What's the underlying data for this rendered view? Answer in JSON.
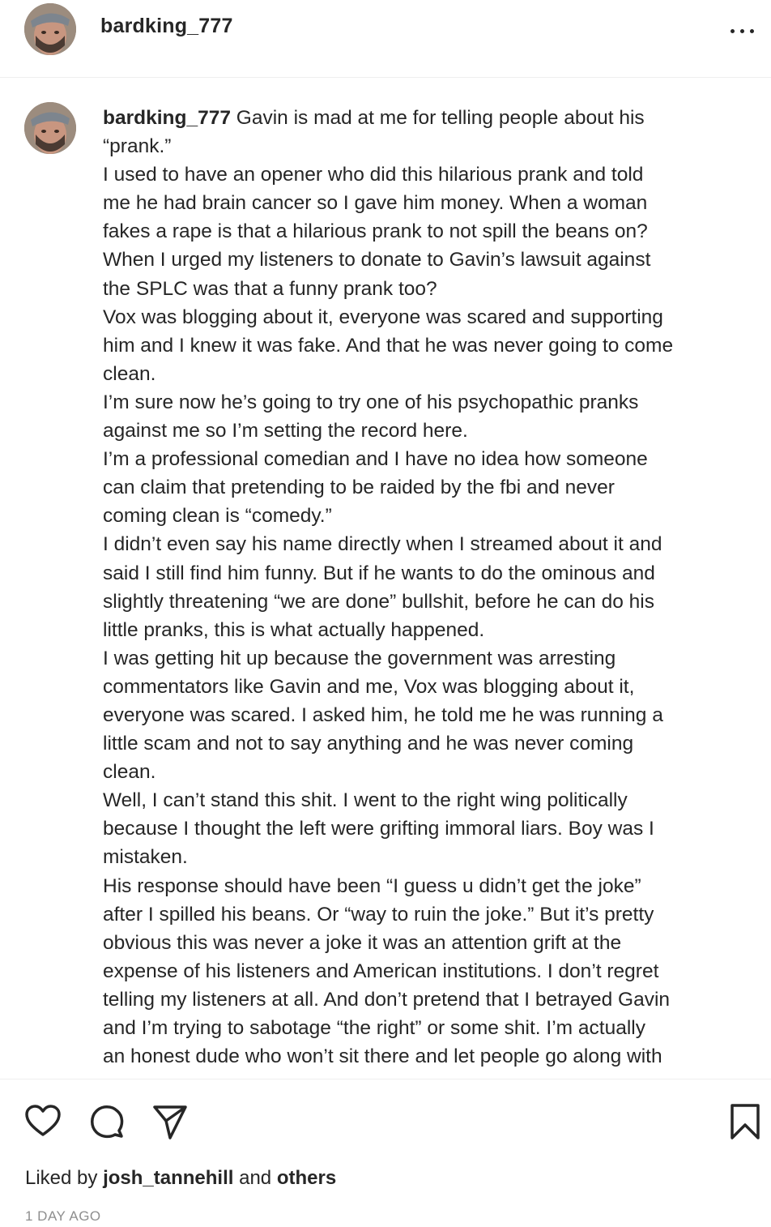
{
  "post": {
    "author": "bardking_777",
    "more_icon": "more-horizontal-icon"
  },
  "comment": {
    "author": "bardking_777",
    "first_line": "Gavin is mad at me for telling people about his",
    "lines": [
      "“prank.”",
      "I used to have an opener who did this hilarious prank and told",
      "me he had brain cancer so I gave him money. When a woman",
      "fakes a rape is that a hilarious prank to not spill the beans on?",
      "When I urged my listeners to donate to Gavin’s lawsuit against",
      "the SPLC was that a funny prank too?",
      "Vox was blogging about it, everyone was scared and supporting",
      "him and I knew it was fake. And that he was never going to come",
      "clean.",
      "I’m sure now he’s going to try one of his psychopathic pranks",
      "against me so I’m setting the record here.",
      "I’m a professional comedian and I have no idea how someone",
      "can claim that pretending to be raided by the fbi and never",
      "coming clean is “comedy.”",
      "I didn’t even say his name directly when I streamed about it and",
      "said I still find him funny. But if he wants to do the ominous and",
      "slightly threatening “we are done” bullshit, before he can do his",
      "little pranks, this is what actually happened.",
      "I was getting hit up because the government was arresting",
      "commentators like Gavin and me, Vox was blogging about it,",
      "everyone was scared. I asked him, he told me he was running a",
      "little scam and not to say anything and he was never coming",
      "clean.",
      "Well, I can’t stand this shit. I went to the right wing politically",
      "because I thought the left were grifting immoral liars. Boy was I",
      "mistaken.",
      "His response should have been “I guess u didn’t get the joke”",
      "after I spilled his beans. Or “way to ruin the joke.” But it’s pretty",
      "obvious this was never a joke it was an attention grift at the",
      "expense of his listeners and American institutions. I don’t regret",
      "telling my listeners at all. And don’t pretend that I betrayed Gavin",
      "and I’m trying to sabotage “the right” or some shit. I’m actually",
      "an honest dude who won’t sit there and let people go along with"
    ]
  },
  "actions": {
    "like_icon": "heart-icon",
    "comment_icon": "comment-bubble-icon",
    "share_icon": "send-icon",
    "save_icon": "bookmark-icon"
  },
  "likes": {
    "prefix": "Liked by",
    "user": "josh_tannehill",
    "joiner": "and",
    "others": "others"
  },
  "timestamp": "1 DAY AGO"
}
